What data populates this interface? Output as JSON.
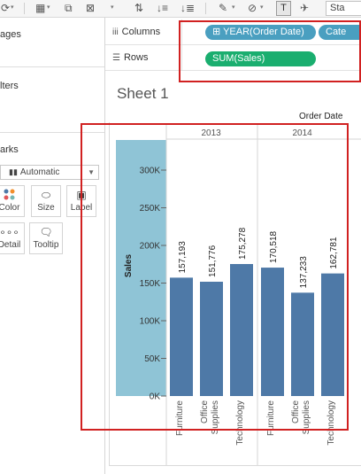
{
  "toolbar": {
    "icons": [
      "undo-dropdown-icon",
      "new-sheet-icon",
      "duplicate-sheet-icon",
      "clear-sheet-icon",
      "swap-axes-icon",
      "sort-ascending-icon",
      "sort-descending-icon",
      "highlight-icon",
      "group-icon",
      "show-labels-icon",
      "pin-icon"
    ],
    "label_toggle": "T",
    "fit_select": "Sta"
  },
  "left_pane": {
    "pages_title": "ages",
    "filters_title": "lters",
    "marks_title": "arks",
    "mark_type": "Automatic",
    "mark_buttons": [
      {
        "label": "Color",
        "icon": "color-icon"
      },
      {
        "label": "Size",
        "icon": "size-icon"
      },
      {
        "label": "Label",
        "icon": "label-icon"
      },
      {
        "label": "Detail",
        "icon": "detail-icon"
      },
      {
        "label": "Tooltip",
        "icon": "tooltip-icon"
      }
    ]
  },
  "shelves": {
    "columns_label": "Columns",
    "rows_label": "Rows",
    "columns_pills": [
      "⊞ YEAR(Order Date)",
      "Cate"
    ],
    "rows_pills": [
      "SUM(Sales)"
    ]
  },
  "view": {
    "sheet_title": "Sheet 1",
    "column_header_label": "Order Date"
  },
  "colors": {
    "bar": "#4e79a7",
    "axis_highlight": "#8fc4d6",
    "pill_blue": "#4a9fc0",
    "pill_green": "#1aae6f",
    "annotation_red": "#d12121"
  },
  "chart_data": {
    "type": "bar",
    "title": "Sheet 1",
    "xlabel": "",
    "ylabel": "Sales",
    "ylim": [
      0,
      340000
    ],
    "y_ticks": [
      0,
      50000,
      100000,
      150000,
      200000,
      250000,
      300000
    ],
    "y_tick_labels": [
      "0K",
      "50K",
      "100K",
      "150K",
      "200K",
      "250K",
      "300K"
    ],
    "column_groups": [
      "2013",
      "2014"
    ],
    "categories": [
      "Furniture",
      "Office Supplies",
      "Technology"
    ],
    "series": [
      {
        "name": "2013",
        "values": [
          157193,
          151776,
          175278
        ],
        "value_labels": [
          "157,193",
          "151,776",
          "175,278"
        ]
      },
      {
        "name": "2014",
        "values": [
          170518,
          137233,
          162781
        ],
        "value_labels": [
          "170,518",
          "137,233",
          "162,781"
        ]
      }
    ],
    "category_labels": [
      [
        "Furniture"
      ],
      [
        "Office",
        "Supplies"
      ],
      [
        "Technology"
      ]
    ],
    "grid": false
  }
}
